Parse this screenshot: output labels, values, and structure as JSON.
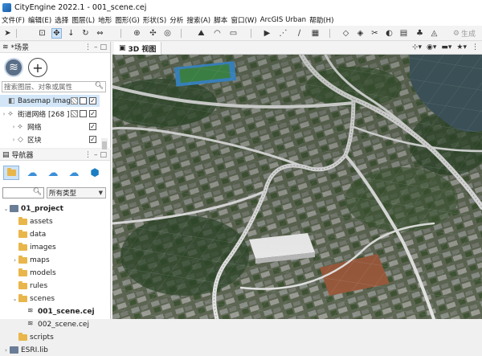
{
  "window": {
    "title": "CityEngine 2022.1 - 001_scene.cej"
  },
  "menubar": {
    "items": [
      "文件(F)",
      "编辑(E)",
      "选择",
      "图层(L)",
      "地形",
      "图形(G)",
      "形状(S)",
      "分析",
      "搜索(A)",
      "脚本",
      "窗口(W)",
      "ArcGIS Urban",
      "帮助(H)"
    ]
  },
  "toolbar": {
    "generate_label": "生成"
  },
  "scene_panel": {
    "title": "*场景",
    "search_placeholder": "搜索图层、对象或属性",
    "layers": [
      {
        "label": "Basemap Imag",
        "selected": true,
        "checked": true
      },
      {
        "label": "街道网络 [268 ]",
        "selected": false,
        "checked": true
      },
      {
        "label": "网络",
        "selected": false,
        "checked": true
      },
      {
        "label": "区块",
        "selected": false,
        "checked": true
      }
    ]
  },
  "navigator_panel": {
    "title": "导航器",
    "type_filter": "所有类型",
    "tree": [
      {
        "label": "01_project",
        "depth": 0,
        "bold": true,
        "expanded": true,
        "kind": "project"
      },
      {
        "label": "assets",
        "depth": 1,
        "kind": "folder"
      },
      {
        "label": "data",
        "depth": 1,
        "kind": "folder"
      },
      {
        "label": "images",
        "depth": 1,
        "kind": "folder"
      },
      {
        "label": "maps",
        "depth": 1,
        "kind": "folder",
        "collapsible": true
      },
      {
        "label": "models",
        "depth": 1,
        "kind": "folder"
      },
      {
        "label": "rules",
        "depth": 1,
        "kind": "folder"
      },
      {
        "label": "scenes",
        "depth": 1,
        "kind": "folder",
        "expanded": true
      },
      {
        "label": "001_scene.cej",
        "depth": 2,
        "bold": true,
        "kind": "scene-file"
      },
      {
        "label": "002_scene.cej",
        "depth": 2,
        "kind": "scene-file"
      },
      {
        "label": "scripts",
        "depth": 1,
        "kind": "folder"
      },
      {
        "label": "ESRI.lib",
        "depth": 0,
        "kind": "project",
        "partial": true
      }
    ]
  },
  "view": {
    "tab_label": "3D 视图"
  },
  "colors": {
    "selection": "#d3e6f8",
    "folder": "#e8b64a",
    "accent": "#1b5ea8"
  }
}
